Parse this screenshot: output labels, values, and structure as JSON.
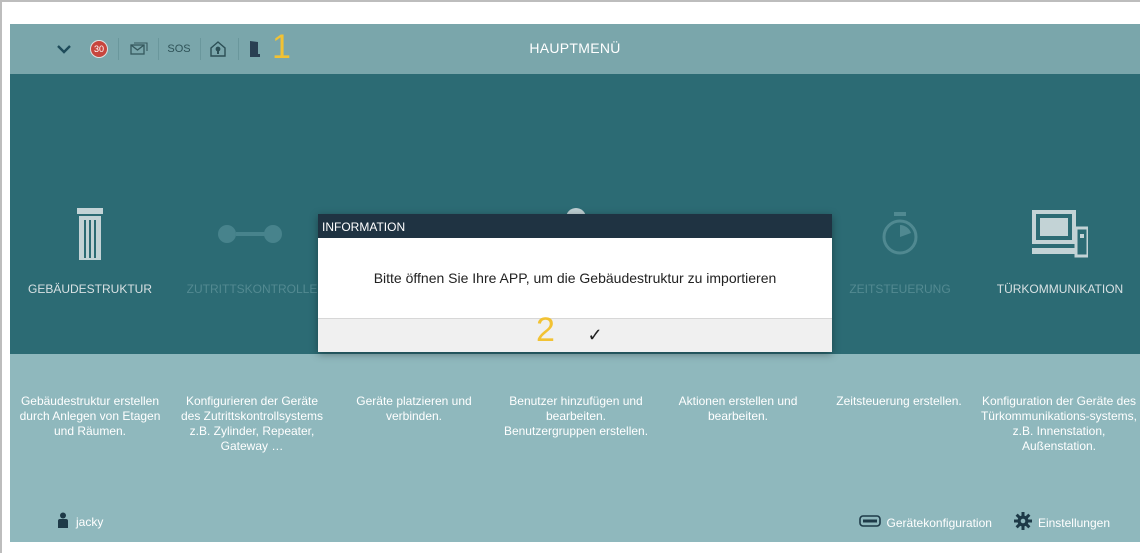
{
  "topbar": {
    "title": "HAUPTMENÜ",
    "badge_count": "30",
    "sos_label": "SOS",
    "marker": "1"
  },
  "modules": [
    {
      "label": "GEBÄUDESTRUKTUR",
      "icon": "building-icon",
      "dim": false
    },
    {
      "label": "ZUTRITTSKONTROLLE",
      "icon": "access-control-icon",
      "dim": true
    },
    {
      "label": "",
      "icon": "device-icon",
      "dim": true
    },
    {
      "label": "",
      "icon": "user-icon",
      "dim": true
    },
    {
      "label": "",
      "icon": "action-icon",
      "dim": true
    },
    {
      "label": "ZEITSTEUERUNG",
      "icon": "timer-icon",
      "dim": true
    },
    {
      "label": "TÜRKOMMUNIKATION",
      "icon": "door-communication-icon",
      "dim": false
    }
  ],
  "descriptions": [
    "Gebäudestruktur erstellen durch Anlegen von Etagen und Räumen.",
    "Konfigurieren der Geräte des Zutrittskontrollsystems z.B. Zylinder, Repeater, Gateway …",
    "Geräte platzieren und verbinden.",
    "Benutzer hinzufügen und bearbeiten. Benutzergruppen erstellen.",
    "Aktionen erstellen und bearbeiten.",
    "Zeitsteuerung erstellen.",
    "Konfiguration der Geräte des Türkommunikations-systems, z.B. Innenstation, Außenstation."
  ],
  "footer": {
    "user": "jacky",
    "device_config": "Gerätekonfiguration",
    "settings": "Einstellungen"
  },
  "modal": {
    "title": "INFORMATION",
    "message": "Bitte öffnen Sie Ihre APP, um die Gebäudestruktur zu importieren",
    "confirm": "✓",
    "marker": "2"
  },
  "colors": {
    "band": "#2e6f78",
    "background": "#8fb8bd",
    "topbar": "#7aa6ab",
    "modal_header": "#1f3342",
    "marker": "#f2c233"
  }
}
